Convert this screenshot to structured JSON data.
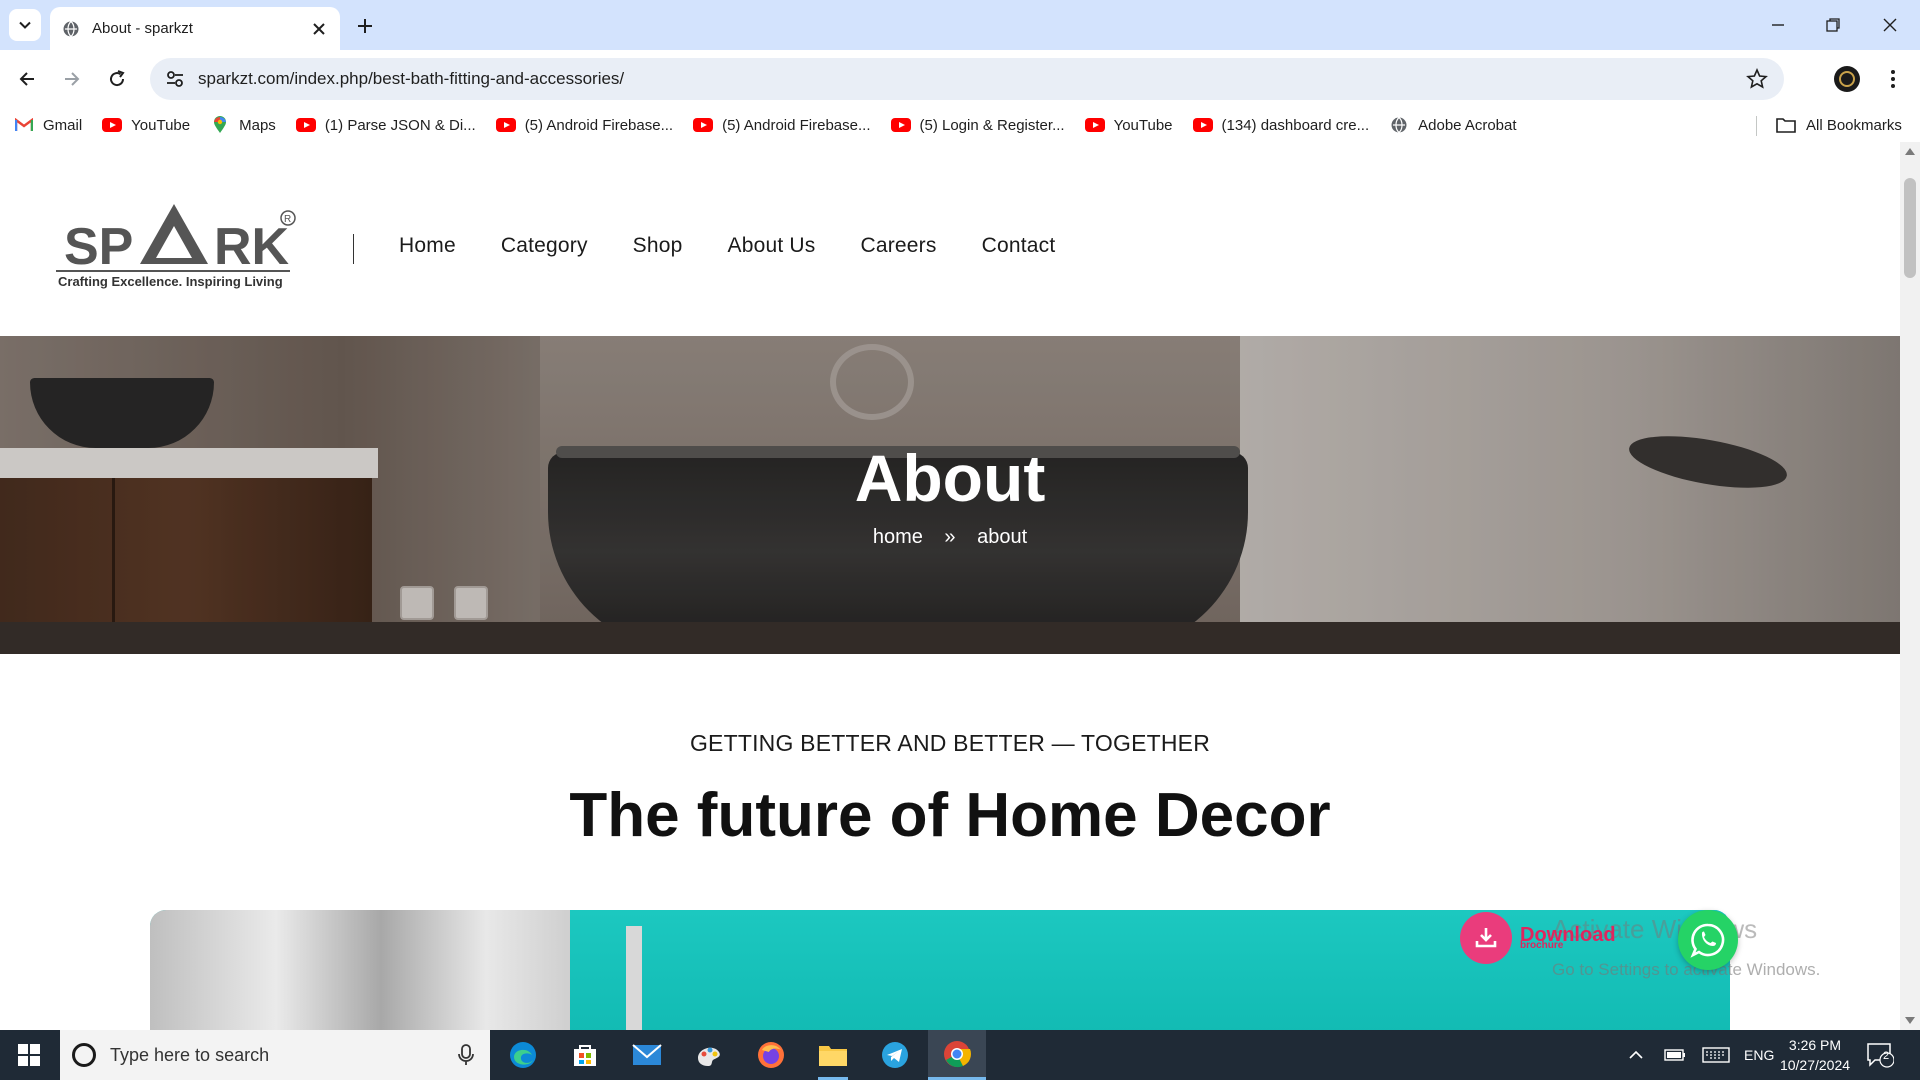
{
  "browser": {
    "tab_title": "About - sparkzt",
    "url": "sparkzt.com/index.php/best-bath-fitting-and-accessories/",
    "bookmarks": [
      {
        "label": "Gmail",
        "icon": "gmail-icon"
      },
      {
        "label": "YouTube",
        "icon": "youtube-icon"
      },
      {
        "label": "Maps",
        "icon": "maps-icon"
      },
      {
        "label": "(1) Parse JSON & Di...",
        "icon": "youtube-icon"
      },
      {
        "label": "(5) Android Firebase...",
        "icon": "youtube-icon"
      },
      {
        "label": "(5) Android Firebase...",
        "icon": "youtube-icon"
      },
      {
        "label": "(5) Login & Register...",
        "icon": "youtube-icon"
      },
      {
        "label": "YouTube",
        "icon": "youtube-icon"
      },
      {
        "label": "(134) dashboard cre...",
        "icon": "youtube-icon"
      },
      {
        "label": "Adobe Acrobat",
        "icon": "globe-icon"
      }
    ],
    "all_bookmarks": "All Bookmarks"
  },
  "site": {
    "logo": {
      "text": "SPARK",
      "registered": "®",
      "tagline": "Crafting Excellence. Inspiring Living"
    },
    "nav": [
      "Home",
      "Category",
      "Shop",
      "About Us",
      "Careers",
      "Contact"
    ],
    "hero": {
      "title": "About",
      "crumb_home": "home",
      "crumb_sep": "»",
      "crumb_current": "about"
    },
    "subhead": "GETTING BETTER AND BETTER — TOGETHER",
    "headline": "The future of Home Decor",
    "download": {
      "label": "Download",
      "sub": "brochure"
    },
    "watermark": {
      "line1": "Activate Windows",
      "line2": "Go to Settings to activate Windows."
    }
  },
  "taskbar": {
    "search_placeholder": "Type here to search",
    "lang": "ENG",
    "time": "3:26 PM",
    "date": "10/27/2024",
    "notifications": "2"
  },
  "colors": {
    "accent_pink": "#ea3c7c",
    "whatsapp_green": "#25d366",
    "chrome_blue": "#d3e3fd"
  }
}
